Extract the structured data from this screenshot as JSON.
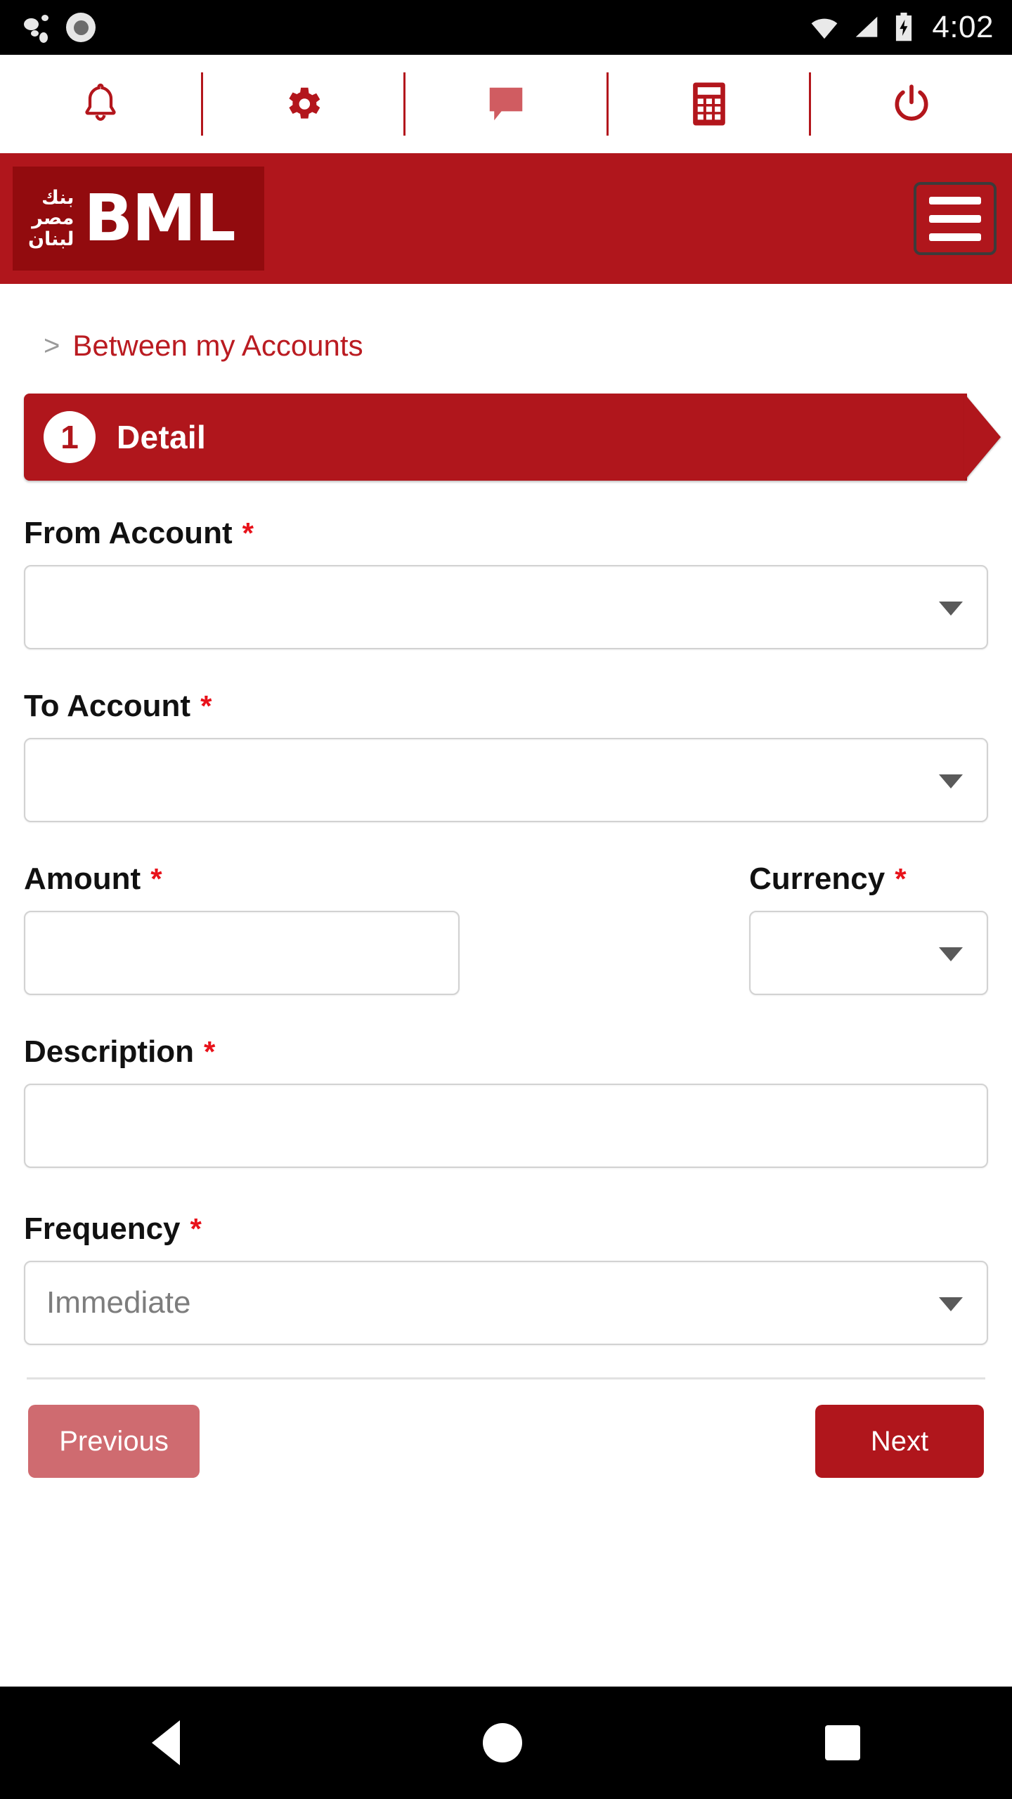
{
  "status_bar": {
    "time": "4:02",
    "icons": [
      "notification-dots",
      "screen-record-icon",
      "wifi-icon",
      "cellular-signal-icon",
      "battery-charging-icon"
    ]
  },
  "quick_toolbar": {
    "items": [
      {
        "name": "notifications",
        "icon": "bell-icon"
      },
      {
        "name": "settings",
        "icon": "gear-icon"
      },
      {
        "name": "messages",
        "icon": "chat-bubble-icon"
      },
      {
        "name": "calculator",
        "icon": "calculator-icon"
      },
      {
        "name": "logout",
        "icon": "power-icon"
      }
    ]
  },
  "header": {
    "logo_arabic_lines": [
      "بنك",
      "مصر",
      "لبنان"
    ],
    "logo_text": "BML",
    "menu_label": "Menu"
  },
  "breadcrumb": {
    "separator": ">",
    "current": "Between my Accounts"
  },
  "step": {
    "number": "1",
    "label": "Detail"
  },
  "form": {
    "required_marker": "*",
    "fields": [
      {
        "label": "From Account",
        "type": "select",
        "value": "",
        "placeholder": ""
      },
      {
        "label": "To Account",
        "type": "select",
        "value": "",
        "placeholder": ""
      },
      {
        "label": "Amount",
        "type": "text",
        "value": "",
        "placeholder": ""
      },
      {
        "label": "Currency",
        "type": "select",
        "value": "",
        "placeholder": ""
      },
      {
        "label": "Description",
        "type": "text",
        "value": "",
        "placeholder": ""
      },
      {
        "label": "Frequency",
        "type": "select",
        "value": "Immediate",
        "placeholder": ""
      }
    ]
  },
  "actions": {
    "previous_label": "Previous",
    "next_label": "Next"
  },
  "nav_bar": {
    "back": "back-button",
    "home": "home-button",
    "recents": "recents-button"
  },
  "colors": {
    "brand_red": "#B0161C",
    "logo_box_red": "#920B0E",
    "link_red": "#BA1B21",
    "required_red": "#E8121A",
    "disabled_red": "#CF6B70",
    "border_gray": "#d2d2d2",
    "placeholder_gray": "#7d7d7d"
  }
}
